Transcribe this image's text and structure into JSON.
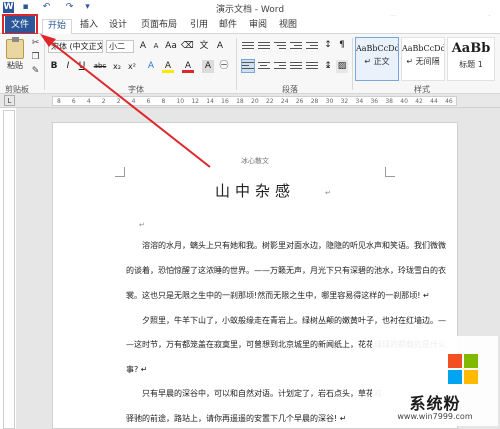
{
  "window": {
    "title": "演示文档 - Word"
  },
  "quick_access": [
    {
      "name": "word-logo-icon",
      "glyph": "W"
    },
    {
      "name": "save-icon",
      "glyph": "▪"
    },
    {
      "name": "undo-icon",
      "glyph": "↶"
    },
    {
      "name": "redo-icon",
      "glyph": "↷"
    },
    {
      "name": "quick-access-menu-icon",
      "glyph": "▾"
    }
  ],
  "tabs": {
    "file": "文件",
    "start": "开始",
    "insert": "插入",
    "design": "设计",
    "layout": "页面布局",
    "references": "引用",
    "mailings": "邮件",
    "review": "审阅",
    "view": "视图"
  },
  "ribbon": {
    "clipboard": {
      "paste_label": "粘贴",
      "group_label": "剪贴板"
    },
    "font": {
      "font_name": "宋体 (中文正文)",
      "font_size": "小二",
      "group_label": "字体",
      "bold": "B",
      "italic": "I",
      "underline": "U",
      "strike": "abc",
      "subscript": "x₂",
      "superscript": "x²",
      "font_color_glyph": "A",
      "highlight_glyph": "A",
      "grow_glyph": "A",
      "shrink_glyph": "A"
    },
    "paragraph": {
      "group_label": "段落"
    },
    "styles": {
      "group_label": "样式",
      "items": [
        {
          "sample": "AaBbCcDd",
          "name": "↵ 正文"
        },
        {
          "sample": "AaBbCcDd",
          "name": "↵ 无间隔"
        },
        {
          "sample": "AaBb",
          "name": "标题 1"
        }
      ]
    }
  },
  "ruler": {
    "numbers": [
      "8",
      "6",
      "4",
      "2",
      "2",
      "4",
      "6",
      "8",
      "10",
      "12",
      "14",
      "16",
      "18",
      "20",
      "22",
      "24",
      "26",
      "28",
      "30",
      "32",
      "34",
      "36",
      "38",
      "40",
      "42",
      "44",
      "46"
    ]
  },
  "document": {
    "header": "冰心散文",
    "title": "山中杂感",
    "return_mark": "↵",
    "lines": [
      "溶溶的水月，螭头上只有她和我。树影里对面水边，隐隐的听见水声和笑语。我们微微",
      "的谈着，恐怕惊醒了这浓睡的世界。——万籁无声，月光下只有深碧的池水，玲珑雪白的衣",
      "裳。这也只是无限之生中的一刹那顷!然而无限之生中，哪里容易得这样的一刹那顷! ↵",
      "夕照里，牛羊下山了，小蚁般缘走在青岩上。绿树丛颠的嫩黄叶子，也衬在红墙边。—",
      "—这时节，万有都笼盖在寂寞里，可曾想到北京城里的新闻纸上，花花绿绿的都载的是什么",
      "事? ↵",
      "只有早晨的深谷中，可以和自然对语。计划定了，岩石点头，草花欢",
      "驿驰的前途，路站上，请你再遥遥的安置下几个早晨的深谷! ↵"
    ]
  },
  "watermark": {
    "title": "系统粉",
    "url": "www.win7999.com",
    "colors": [
      "#f25022",
      "#7fba00",
      "#00a4ef",
      "#ffb900"
    ]
  },
  "colors": {
    "accent": "#2b579a",
    "highlight_box": "#e0262b",
    "arrow": "#e0262b"
  }
}
